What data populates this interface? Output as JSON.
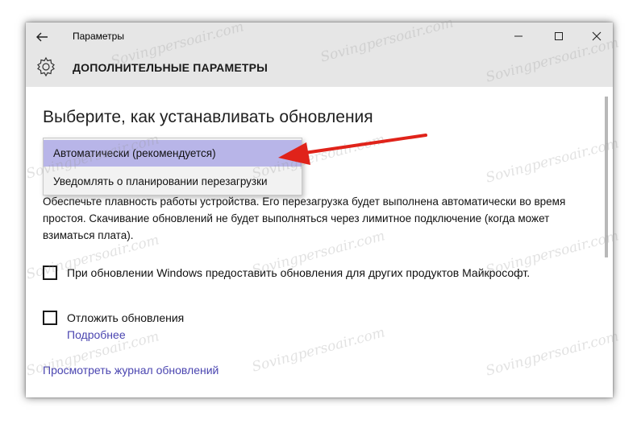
{
  "window": {
    "app_title": "Параметры",
    "page_title": "ДОПОЛНИТЕЛЬНЫЕ ПАРАМЕТРЫ"
  },
  "content": {
    "section_title": "Выберите, как устанавливать обновления",
    "dropdown": {
      "options": [
        "Автоматически (рекомендуется)",
        "Уведомлять о планировании перезагрузки"
      ],
      "selected": "Автоматически (рекомендуется)"
    },
    "description": "Обеспечьте плавность работы устройства. Его перезагрузка будет выполнена автоматически во время простоя. Скачивание обновлений не будет выполняться через лимитное подключение (когда может взиматься плата).",
    "checkbox_other_products": "При обновлении Windows предоставить обновления для других продуктов Майкрософт.",
    "checkbox_defer": "Отложить обновления",
    "link_details": "Подробнее",
    "link_history": "Просмотреть журнал обновлений"
  },
  "watermark": "Sovingpersoair.com",
  "annotation": {
    "arrow_color": "#e0231a"
  }
}
